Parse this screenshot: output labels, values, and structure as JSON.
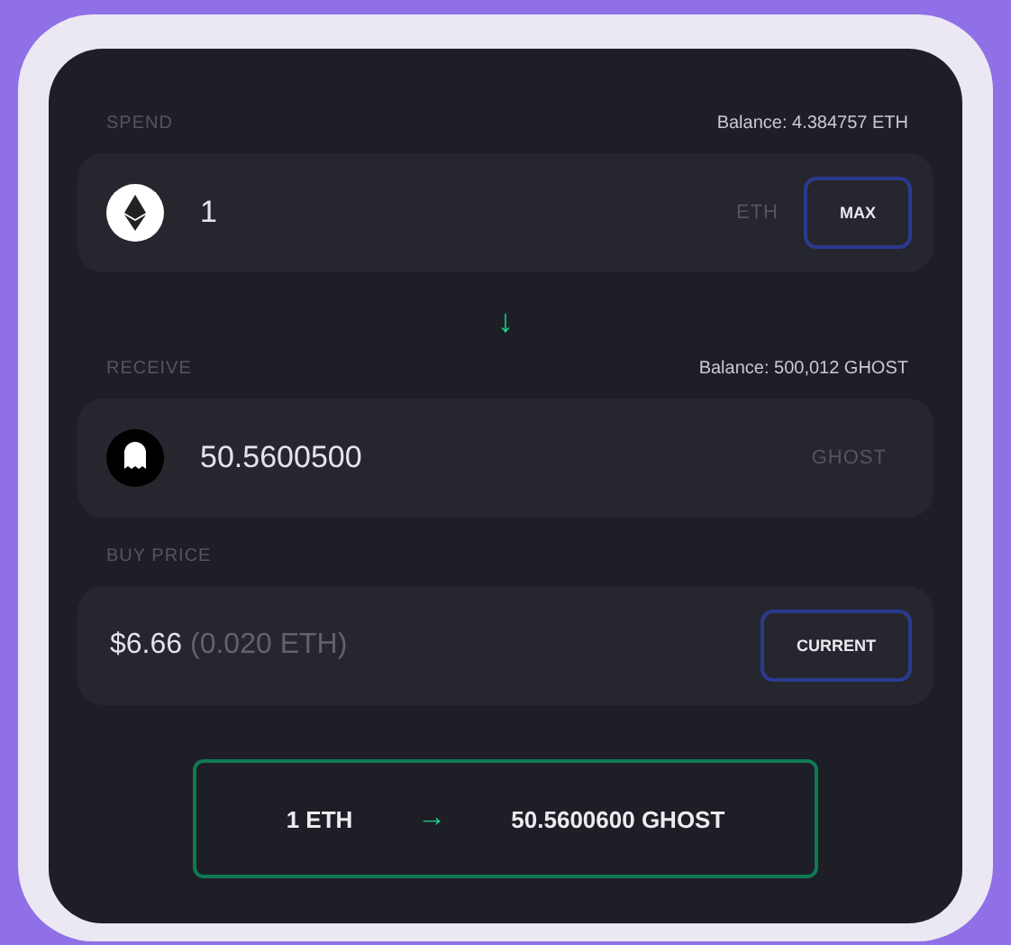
{
  "spend": {
    "label": "SPEND",
    "balance": "Balance: 4.384757 ETH",
    "value": "1",
    "unit": "ETH",
    "button": "MAX"
  },
  "swap_arrow": "↓",
  "receive": {
    "label": "RECEIVE",
    "balance": "Balance: 500,012 GHOST",
    "value": "50.5600500",
    "unit": "GHOST"
  },
  "buy_price": {
    "label": "BUY PRICE",
    "price": "$6.66",
    "eth_price": "(0.020 ETH)",
    "button": "CURRENT"
  },
  "confirm": {
    "from": "1 ETH",
    "arrow": "→",
    "to": "50.5600600 GHOST"
  }
}
